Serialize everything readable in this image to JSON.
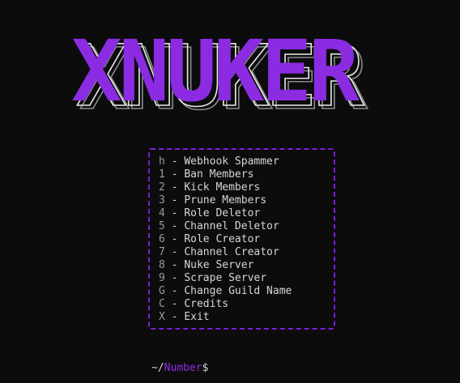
{
  "logo": {
    "text": "XNUKER"
  },
  "menu": {
    "items": [
      {
        "key": "h",
        "label": "Webhook Spammer"
      },
      {
        "key": "1",
        "label": "Ban Members"
      },
      {
        "key": "2",
        "label": "Kick Members"
      },
      {
        "key": "3",
        "label": "Prune Members"
      },
      {
        "key": "4",
        "label": "Role Deletor"
      },
      {
        "key": "5",
        "label": "Channel Deletor"
      },
      {
        "key": "6",
        "label": "Role Creator"
      },
      {
        "key": "7",
        "label": "Channel Creator"
      },
      {
        "key": "8",
        "label": "Nuke Server"
      },
      {
        "key": "9",
        "label": "Scrape Server"
      },
      {
        "key": "G",
        "label": "Change Guild Name"
      },
      {
        "key": "C",
        "label": "Credits"
      },
      {
        "key": "X",
        "label": "Exit"
      }
    ],
    "separator": " - "
  },
  "prompt": {
    "prefix": "~/",
    "word": "Number",
    "suffix": "$"
  },
  "colors": {
    "background": "#0c0c0c",
    "accent": "#8b2be2",
    "text": "#d6d6d6",
    "key": "#9a9a9a"
  }
}
